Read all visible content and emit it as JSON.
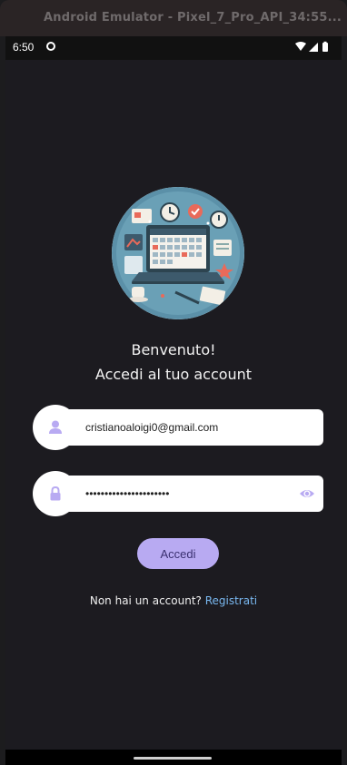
{
  "window": {
    "title": "Android Emulator - Pixel_7_Pro_API_34:55..."
  },
  "status_bar": {
    "time": "6:50"
  },
  "welcome": {
    "line1": "Benvenuto!",
    "line2": "Accedi al tuo account"
  },
  "form": {
    "email_value": "cristianoaloigi0@gmail.com",
    "password_value": "••••••••••••••••••••••"
  },
  "actions": {
    "login_label": "Accedi",
    "signup_prompt": "Non hai un account?",
    "signup_link": "Registrati"
  },
  "colors": {
    "accent": "#b8aaf2",
    "link": "#79b8f0",
    "background": "#1c1b20"
  }
}
